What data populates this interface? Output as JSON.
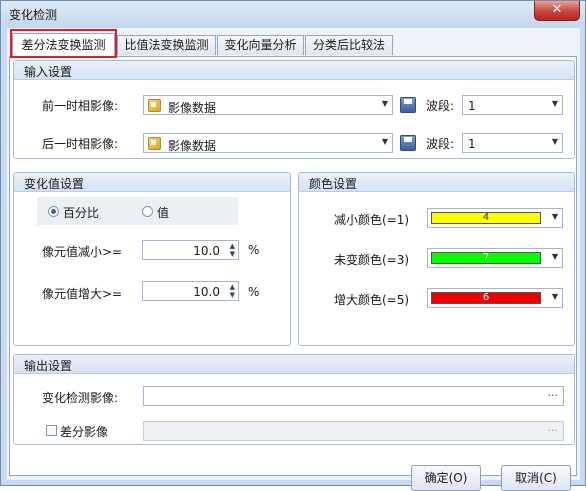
{
  "window": {
    "title": "变化检测",
    "close_glyph": "✕"
  },
  "tabs": [
    "差分法变换监测",
    "比值法变换监测",
    "变化向量分析",
    "分类后比较法"
  ],
  "input_settings": {
    "title": "输入设置",
    "before_label": "前一时相影像:",
    "before_value": "影像数据",
    "after_label": "后一时相影像:",
    "after_value": "影像数据",
    "band_label": "波段:",
    "band_before": "1",
    "band_after": "1"
  },
  "change_settings": {
    "title": "变化值设置",
    "radio_percent": "百分比",
    "radio_value": "值",
    "selected": "百分比",
    "decrease_label": "像元值减小>=",
    "decrease_value": "10.0",
    "increase_label": "像元值增大>=",
    "increase_value": "10.0",
    "unit": "%"
  },
  "color_settings": {
    "title": "颜色设置",
    "items": [
      {
        "label": "减小颜色(=1)",
        "value": "4",
        "color": "#ffff00"
      },
      {
        "label": "未变颜色(=3)",
        "value": "7",
        "color": "#00ff00"
      },
      {
        "label": "增大颜色(=5)",
        "value": "6",
        "color": "#ee0000"
      }
    ]
  },
  "output_settings": {
    "title": "输出设置",
    "result_label": "变化检测影像:",
    "result_value": "",
    "diff_label": "差分影像",
    "diff_checked": false,
    "browse_glyph": "···"
  },
  "buttons": {
    "ok": "确定(O)",
    "cancel": "取消(C)"
  }
}
